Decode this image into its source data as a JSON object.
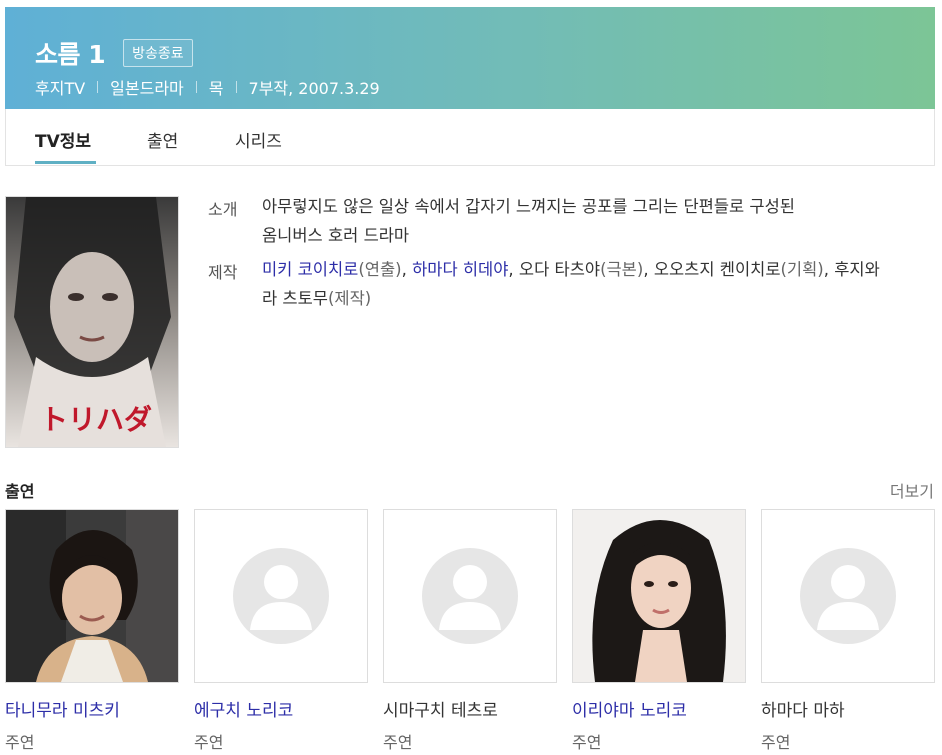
{
  "header": {
    "title": "소름 1",
    "status_badge": "방송종료",
    "meta": [
      "후지TV",
      "일본드라마",
      "목",
      "7부작, 2007.3.29"
    ]
  },
  "tabs": [
    {
      "label": "TV정보",
      "active": true
    },
    {
      "label": "출연",
      "active": false
    },
    {
      "label": "시리즈",
      "active": false
    }
  ],
  "poster": {
    "title_text": "トリハダ"
  },
  "info": {
    "intro_label": "소개",
    "intro_line1": "아무렇지도 않은 일상 속에서 갑자기 느껴지는 공포를 그리는 단편들로 구성된",
    "intro_line2": "옴니버스 호러 드라마",
    "production_label": "제작",
    "credits": [
      {
        "name": "미키 코이치로",
        "role": "(연출)",
        "link": true
      },
      {
        "name": "하마다 히데야",
        "role": "",
        "link": true
      },
      {
        "name": "오다 타츠야",
        "role": "(극본)",
        "link": false
      },
      {
        "name": "오오츠지 켄이치로",
        "role": "(기획)",
        "link": false
      },
      {
        "name": "후지와라 츠토무",
        "role": "(제작)",
        "link": false
      }
    ]
  },
  "cast": {
    "heading": "출연",
    "more_label": "더보기",
    "members": [
      {
        "name": "타니무라 미츠키",
        "role": "주연",
        "link": true,
        "photo": true
      },
      {
        "name": "에구치 노리코",
        "role": "주연",
        "link": true,
        "photo": false
      },
      {
        "name": "시마구치 테츠로",
        "role": "주연",
        "link": false,
        "photo": false
      },
      {
        "name": "이리야마 노리코",
        "role": "주연",
        "link": true,
        "photo": true
      },
      {
        "name": "하마다 마하",
        "role": "주연",
        "link": false,
        "photo": false
      }
    ]
  },
  "colors": {
    "banner_start": "#5fb0d6",
    "banner_end": "#7cc596",
    "link": "#2d2ea8",
    "tab_underline": "#5fb0c4"
  }
}
